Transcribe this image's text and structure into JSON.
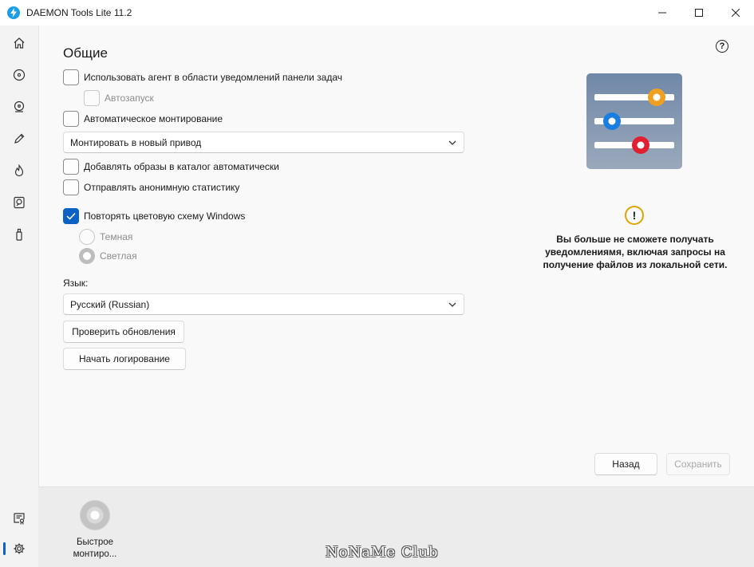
{
  "window": {
    "title": "DAEMON Tools Lite 11.2"
  },
  "settings": {
    "heading": "Общие",
    "options": {
      "tray_agent": {
        "label": "Использовать агент в области уведомлений панели задач",
        "checked": false
      },
      "autostart": {
        "label": "Автозапуск",
        "checked": false,
        "disabled": true
      },
      "auto_mount": {
        "label": "Автоматическое монтирование",
        "checked": false
      },
      "add_to_catalog": {
        "label": "Добавлять образы в каталог автоматически",
        "checked": false
      },
      "anon_stats": {
        "label": "Отправлять анонимную статистику",
        "checked": false
      },
      "follow_theme": {
        "label": "Повторять цветовую схему Windows",
        "checked": true
      }
    },
    "mount_select": {
      "value": "Монтировать в новый привод"
    },
    "theme": {
      "dark": {
        "label": "Темная",
        "selected": false
      },
      "light": {
        "label": "Светлая",
        "selected": true
      }
    },
    "language": {
      "label": "Язык:",
      "value": "Русский (Russian)"
    },
    "buttons": {
      "check_updates": "Проверить обновления",
      "start_logging": "Начать логирование",
      "back": "Назад",
      "save": "Сохранить"
    }
  },
  "info": {
    "warning": "Вы больше не сможете получать уведомлениямя, включая запросы на получение файлов из локальной сети."
  },
  "bottom": {
    "quick_mount_label": "Быстрое монтиро..."
  },
  "watermark": "NoNaMe Club",
  "colors": {
    "accent": "#0b62c4",
    "slider_orange": "#f0a020",
    "slider_blue": "#1a7ee0",
    "slider_red": "#e02030",
    "warning": "#e0a400"
  }
}
